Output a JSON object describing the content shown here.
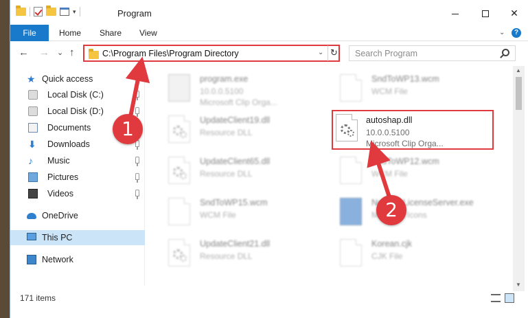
{
  "window": {
    "title": "Program",
    "controls": {
      "minimize": "—",
      "maximize": "☐",
      "close": "✕"
    }
  },
  "ribbon": {
    "tabs": [
      "File",
      "Home",
      "Share",
      "View"
    ],
    "help": "?"
  },
  "nav": {
    "back": "←",
    "forward": "→",
    "recent": "⌄",
    "up": "↑",
    "address": "C:\\Program Files\\Program Directory",
    "refresh": "↻",
    "search_placeholder": "Search Program"
  },
  "navpane": {
    "items": [
      {
        "label": "Quick access",
        "icon": "star-icon"
      },
      {
        "label": "Local Disk (C:)",
        "icon": "disk-icon",
        "pinned": true
      },
      {
        "label": "Local Disk (D:)",
        "icon": "disk-icon",
        "pinned": true
      },
      {
        "label": "Documents",
        "icon": "documents-icon",
        "pinned": true
      },
      {
        "label": "Downloads",
        "icon": "download-icon",
        "pinned": true
      },
      {
        "label": "Music",
        "icon": "music-icon",
        "pinned": true
      },
      {
        "label": "Pictures",
        "icon": "pictures-icon",
        "pinned": true
      },
      {
        "label": "Videos",
        "icon": "videos-icon",
        "pinned": true
      },
      {
        "label": "OneDrive",
        "icon": "cloud-icon"
      },
      {
        "label": "This PC",
        "icon": "computer-icon",
        "selected": true
      },
      {
        "label": "Network",
        "icon": "network-icon"
      }
    ]
  },
  "files": [
    {
      "name": "program.exe",
      "line1": "10.0.0.5100",
      "line2": "Microsoft Clip Orga...",
      "type": "exe"
    },
    {
      "name": "SndToWP13.wcm",
      "line1": "WCM File",
      "line2": "",
      "type": "doc"
    },
    {
      "name": "UpdateClient19.dll",
      "line1": "Resource DLL",
      "line2": "",
      "type": "dll"
    },
    {
      "name": "autoshap.dll",
      "line1": "10.0.0.5100",
      "line2": "Microsoft Clip Orga...",
      "type": "dll",
      "highlighted": true
    },
    {
      "name": "UpdateClient65.dll",
      "line1": "Resource DLL",
      "line2": "",
      "type": "dll"
    },
    {
      "name": "SndToWP12.wcm",
      "line1": "WCM File",
      "line2": "",
      "type": "doc"
    },
    {
      "name": "SndToWP15.wcm",
      "line1": "WCM File",
      "line2": "",
      "type": "doc"
    },
    {
      "name": "NetworkLicenseServer.exe",
      "line1": "Microsoft Icons",
      "line2": "",
      "type": "app"
    },
    {
      "name": "UpdateClient21.dll",
      "line1": "Resource DLL",
      "line2": "",
      "type": "dll"
    },
    {
      "name": "Korean.cjk",
      "line1": "CJK File",
      "line2": "",
      "type": "doc"
    }
  ],
  "status": {
    "count": "171 items"
  },
  "callouts": [
    "1",
    "2"
  ],
  "colors": {
    "accent": "#1979ca",
    "highlight": "#e0393e",
    "selection": "#cce4f7"
  }
}
